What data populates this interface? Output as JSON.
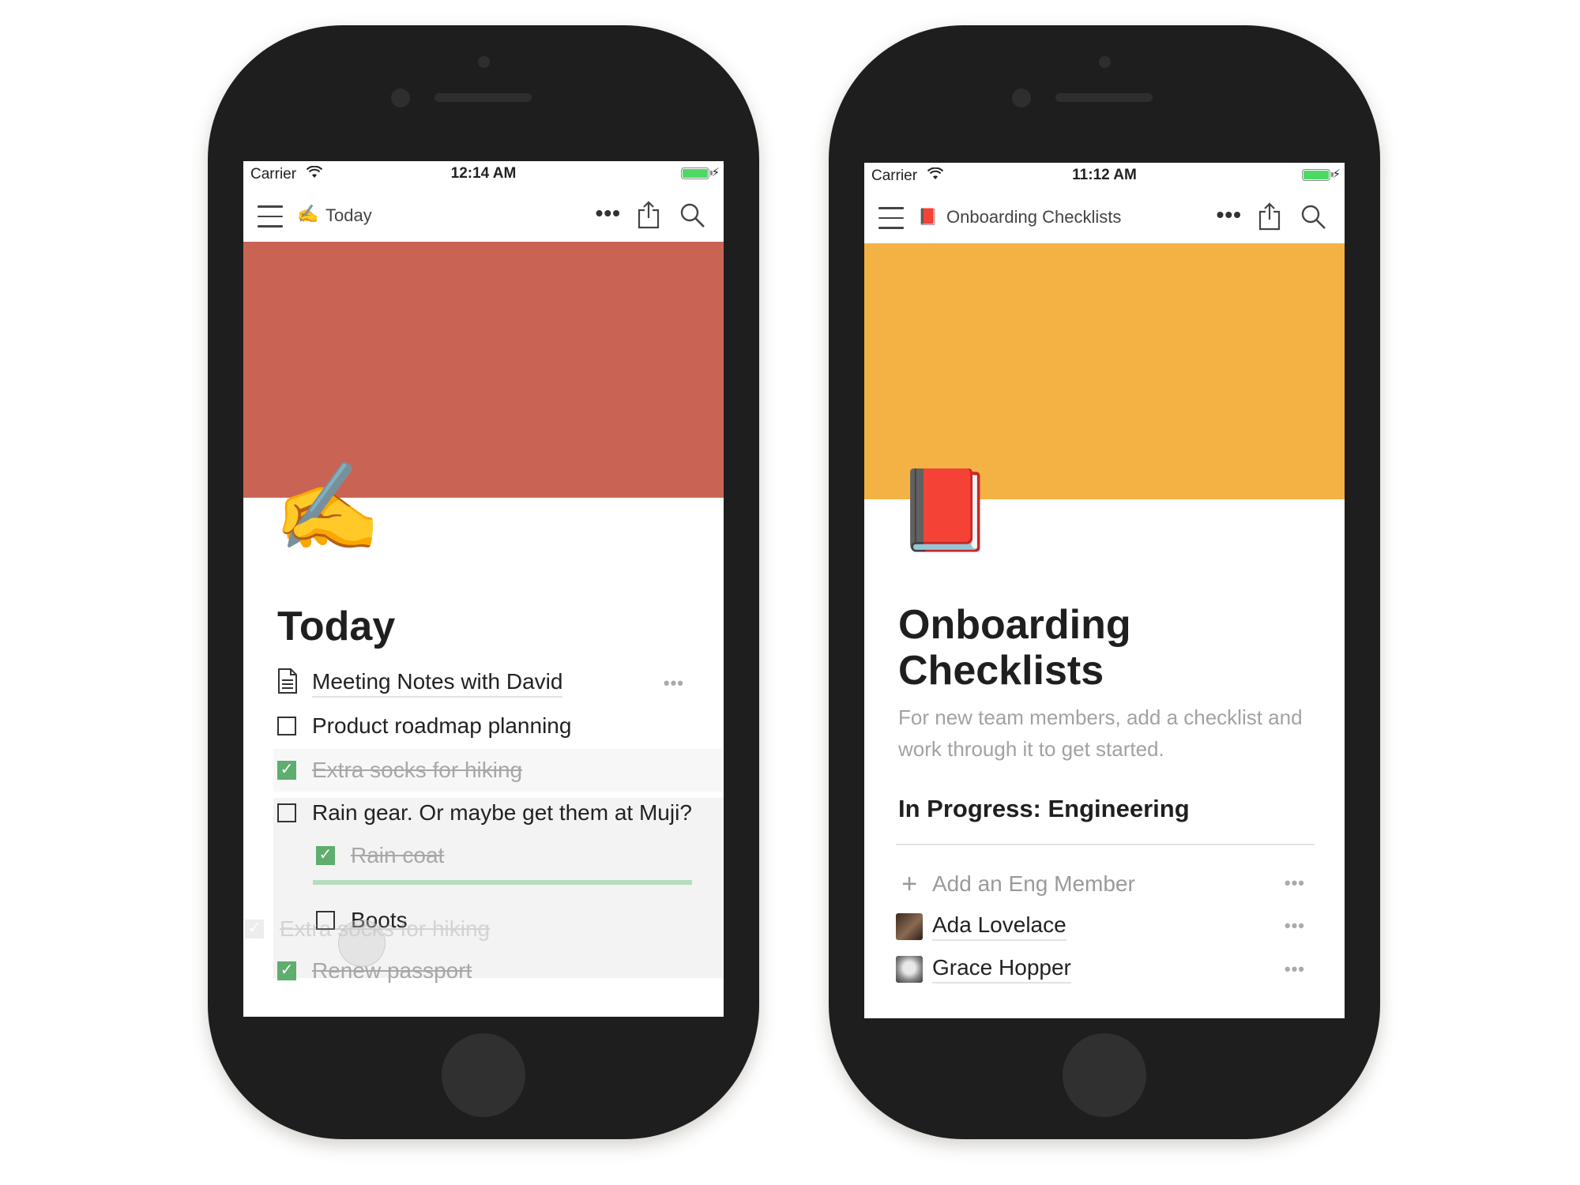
{
  "colors": {
    "device_body": "#1e1e1e",
    "cover_today": "#c96455",
    "cover_onboarding": "#f4b244",
    "checkbox_checked": "#5fad6f",
    "drop_indicator": "#b5dcbe",
    "battery": "#4cd964"
  },
  "phones": [
    {
      "status_bar": {
        "carrier": "Carrier",
        "time": "12:14 AM",
        "wifi_icon": "wifi-icon",
        "battery_icon": "battery-charging-icon"
      },
      "nav": {
        "page_emoji": "✍️",
        "page_title": "Today",
        "menu_icon": "hamburger-menu-icon",
        "more_label": "•••",
        "share_icon": "share-icon",
        "search_icon": "search-icon"
      },
      "page": {
        "icon_emoji": "✍️",
        "title": "Today",
        "blocks": [
          {
            "type": "page-link",
            "icon": "document-icon",
            "text": "Meeting Notes with David",
            "more": "•••"
          },
          {
            "type": "todo",
            "checked": false,
            "text": "Product roadmap planning"
          },
          {
            "type": "todo",
            "checked": true,
            "text": "Extra socks for hiking"
          },
          {
            "type": "todo",
            "checked": false,
            "text": "Rain gear. Or maybe get them at Muji?"
          },
          {
            "type": "todo",
            "checked": true,
            "indent": 1,
            "text": "Rain coat"
          },
          {
            "type": "todo",
            "checked": false,
            "indent": 1,
            "text": "Boots"
          },
          {
            "type": "todo",
            "checked": true,
            "text": "Renew passport"
          }
        ],
        "dragging_ghost": {
          "checked": true,
          "text": "Extra socks for hiking"
        }
      }
    },
    {
      "status_bar": {
        "carrier": "Carrier",
        "time": "11:12 AM",
        "wifi_icon": "wifi-icon",
        "battery_icon": "battery-charging-icon"
      },
      "nav": {
        "page_emoji": "📕",
        "page_title": "Onboarding Checklists",
        "menu_icon": "hamburger-menu-icon",
        "more_label": "•••",
        "share_icon": "share-icon",
        "search_icon": "search-icon"
      },
      "page": {
        "icon_emoji": "📕",
        "title_line1": "Onboarding",
        "title_line2": "Checklists",
        "description": "For new team members, add a checklist and work through it to get started.",
        "section_heading": "In Progress: Engineering",
        "add_label": "Add an Eng Member",
        "members": [
          {
            "name": "Ada Lovelace",
            "more": "•••"
          },
          {
            "name": "Grace Hopper",
            "more": "•••"
          }
        ],
        "add_more": "•••"
      }
    }
  ]
}
